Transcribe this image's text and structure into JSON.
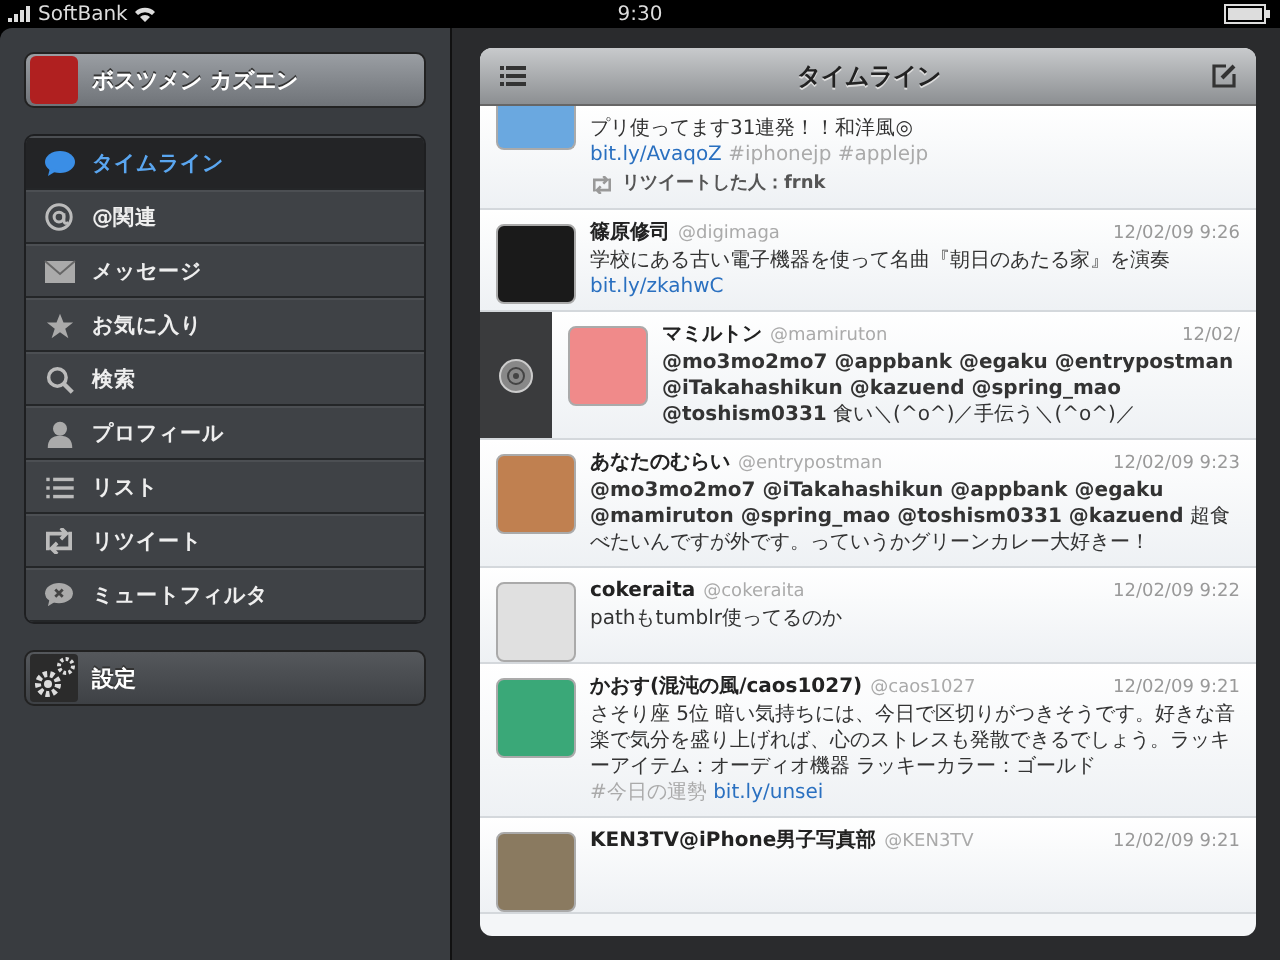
{
  "status_bar": {
    "carrier": "SoftBank",
    "time": "9:30"
  },
  "sidebar": {
    "profile": {
      "name": "ボスツメン カズエン"
    },
    "items": [
      {
        "label": "タイムライン",
        "selected": true
      },
      {
        "label": "@関連",
        "selected": false
      },
      {
        "label": "メッセージ",
        "selected": false
      },
      {
        "label": "お気に入り",
        "selected": false
      },
      {
        "label": "検索",
        "selected": false
      },
      {
        "label": "プロフィール",
        "selected": false
      },
      {
        "label": "リスト",
        "selected": false
      },
      {
        "label": "リツイート",
        "selected": false
      },
      {
        "label": "ミュートフィルタ",
        "selected": false
      }
    ],
    "settings": {
      "label": "設定"
    }
  },
  "timeline": {
    "title": "タイムライン",
    "tweets": [
      {
        "kind": "partial",
        "swiped": false,
        "segments": [
          {
            "kind": "text",
            "text": "プリ使ってます31連発！！和洋風◎ "
          },
          {
            "kind": "link",
            "text": "bit.ly/AvaqoZ"
          },
          {
            "kind": "hashtag",
            "text": " #iphonejp"
          },
          {
            "kind": "hashtag",
            "text": " #applejp"
          }
        ],
        "retweeted_by": "リツイートした人：frnk"
      },
      {
        "kind": "full",
        "swiped": false,
        "name": "篠原修司",
        "handle": "@digimaga",
        "time": "12/02/09 9:26",
        "segments": [
          {
            "kind": "text",
            "text": "学校にある古い電子機器を使って名曲『朝日のあたる家』を演奏 "
          },
          {
            "kind": "link",
            "text": "bit.ly/zkahwC"
          }
        ]
      },
      {
        "kind": "full",
        "swiped": true,
        "name": "マミルトン",
        "handle": "@mamiruton",
        "time": "12/02/",
        "segments": [
          {
            "kind": "mention",
            "text": "@mo3mo2mo7 @appbank @egaku @entrypostman @iTakahashikun @kazuend @spring_mao @toshism0331"
          },
          {
            "kind": "text",
            "text": " 食い＼(^o^)／手伝う＼(^o^)／"
          }
        ]
      },
      {
        "kind": "full",
        "swiped": false,
        "name": "あなたのむらい",
        "handle": "@entrypostman",
        "time": "12/02/09 9:23",
        "segments": [
          {
            "kind": "mention",
            "text": "@mo3mo2mo7 @iTakahashikun @appbank @egaku @mamiruton @spring_mao @toshism0331 @kazuend"
          },
          {
            "kind": "text",
            "text": " 超食べたいんですが外です。っていうかグリーンカレー大好きー！"
          }
        ]
      },
      {
        "kind": "full",
        "swiped": false,
        "name": "cokeraita",
        "handle": "@cokeraita",
        "time": "12/02/09 9:22",
        "segments": [
          {
            "kind": "text",
            "text": "pathもtumblr使ってるのか"
          }
        ]
      },
      {
        "kind": "full",
        "swiped": false,
        "name": "かおす(混沌の風/caos1027)",
        "handle": "@caos1027",
        "time": "12/02/09 9:21",
        "segments": [
          {
            "kind": "text",
            "text": "さそり座 5位 暗い気持ちには、今日で区切りがつきそうです。好きな音楽で気分を盛り上げれば、心のストレスも発散できるでしょう。ラッキーアイテム：オーディオ機器 ラッキーカラー：ゴールド "
          },
          {
            "kind": "hashtag",
            "text": "#今日の運勢"
          },
          {
            "kind": "link",
            "text": " bit.ly/unsei"
          }
        ]
      },
      {
        "kind": "full",
        "swiped": false,
        "name": "KEN3TV@iPhone男子写真部",
        "handle": "@KEN3TV",
        "time": "12/02/09 9:21"
      }
    ]
  }
}
